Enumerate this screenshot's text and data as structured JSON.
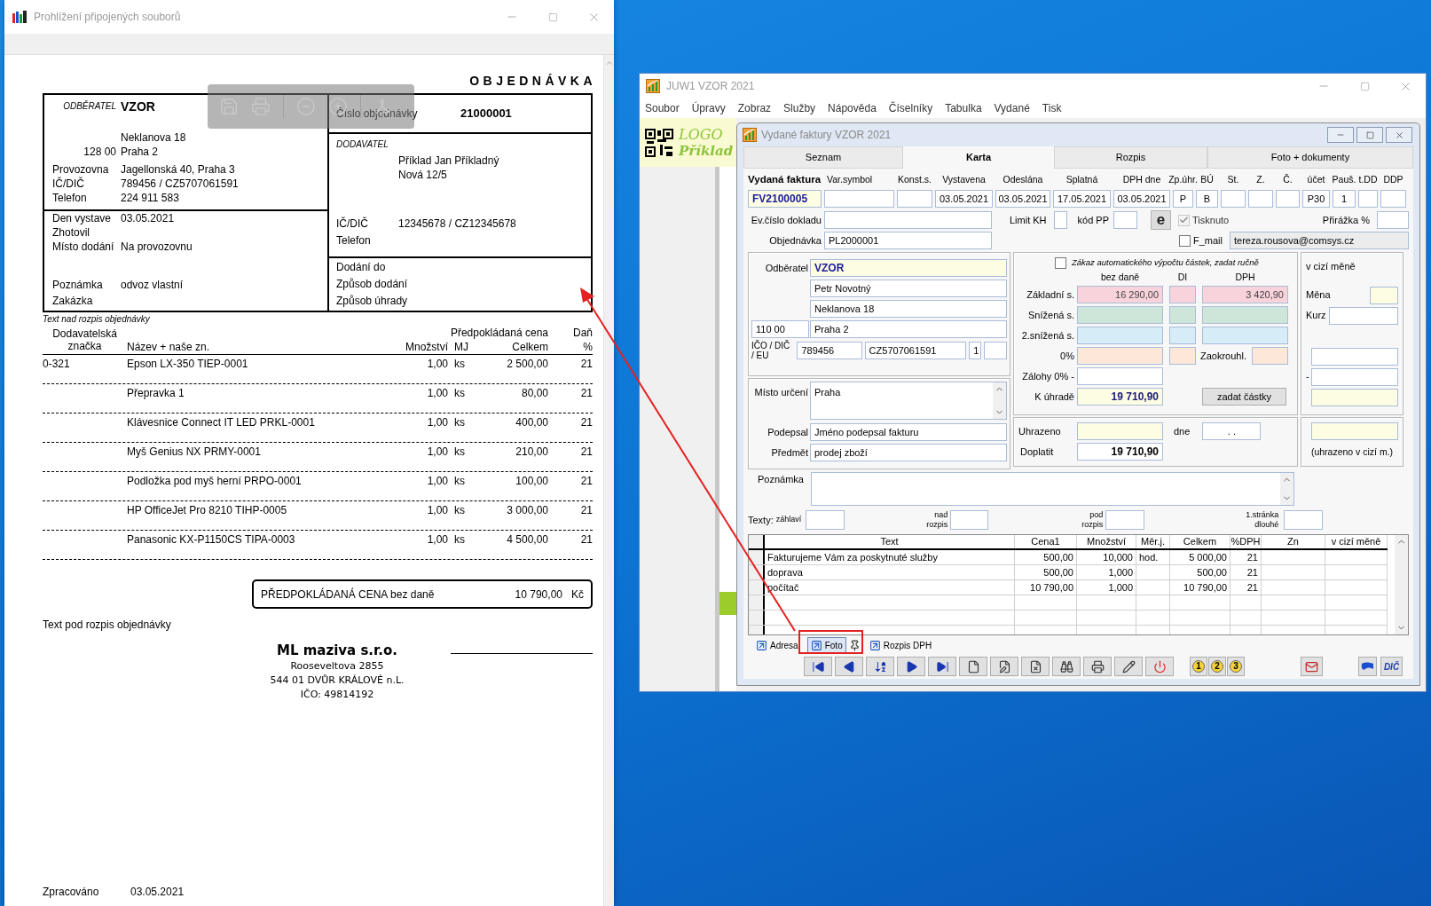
{
  "left_window": {
    "title": "Prohlížení připojených souborů",
    "document": {
      "heading": "OBJEDNÁVKA",
      "customer": {
        "label": "ODBĚRATEL",
        "name": "VZOR",
        "street": "Neklanova 18",
        "zip": "128 00",
        "city": "Praha 2",
        "details": [
          {
            "label": "Provozovna",
            "value": "Jagellonská 40, Praha 3"
          },
          {
            "label": "IČ/DIČ",
            "value": "789456 / CZ5707061591"
          },
          {
            "label": "Telefon",
            "value": "224 911 583"
          }
        ]
      },
      "order_info": [
        {
          "label": "Den vystave",
          "value": "03.05.2021"
        },
        {
          "label": "Zhotovil"
        },
        {
          "label": "Místo dodání",
          "value": "Na provozovnu"
        }
      ],
      "notes": [
        {
          "label": "Poznámka",
          "value": "odvoz vlastní"
        },
        {
          "label": "Zakázka"
        }
      ],
      "order_number": {
        "label": "Číslo objednávky",
        "value": "21000001"
      },
      "supplier": {
        "label": "DODAVATEL",
        "name": "Příklad Jan Příkladný",
        "street": "Nová 12/5",
        "details": [
          {
            "label": "IČ/DIČ",
            "value": "12345678 / CZ12345678"
          },
          {
            "label": "Telefon"
          }
        ]
      },
      "delivery": [
        "Dodání do",
        "Způsob dodání",
        "Způsob úhrady"
      ],
      "text_above": "Text nad rozpis objednávky",
      "columns": {
        "code": "Dodavatelská značka",
        "name": "Název + naše zn.",
        "qty": "Množství",
        "unit": "MJ",
        "price": "Předpokládaná cena",
        "total": "Celkem",
        "tax": "Daň",
        "tax_unit": "%"
      },
      "rows": [
        {
          "code": "0-321",
          "name": "Epson LX-350 TIEP-0001",
          "qty": "1,00",
          "unit": "ks",
          "total": "2 500,00",
          "tax": "21"
        },
        {
          "name": "Přepravka 1",
          "qty": "1,00",
          "unit": "ks",
          "total": "80,00",
          "tax": "21"
        },
        {
          "name": "Klávesnice Connect IT LED PRKL-0001",
          "qty": "1,00",
          "unit": "ks",
          "total": "400,00",
          "tax": "21"
        },
        {
          "name": "Myš Genius NX PRMY-0001",
          "qty": "1,00",
          "unit": "ks",
          "total": "210,00",
          "tax": "21"
        },
        {
          "name": "Podložka pod myš herní PRPO-0001",
          "qty": "1,00",
          "unit": "ks",
          "total": "100,00",
          "tax": "21"
        },
        {
          "name": "HP OfficeJet Pro 8210 TIHP-0005",
          "qty": "1,00",
          "unit": "ks",
          "total": "3 000,00",
          "tax": "21"
        },
        {
          "name": "Panasonic KX-P1150CS TIPA-0003",
          "qty": "1,00",
          "unit": "ks",
          "total": "4 500,00",
          "tax": "21"
        }
      ],
      "total": {
        "label": "PŘEDPOKLÁDANÁ CENA bez daně",
        "value": "10 790,00",
        "currency": "Kč"
      },
      "text_below": "Text pod rozpis objednávky",
      "stamp": {
        "company": "ML maziva s.r.o.",
        "lines": [
          "Rooseveltova 2855",
          "544 01 DVŮR KRÁLOVÉ n.L.",
          "IČO: 49814192"
        ]
      },
      "processed": {
        "label": "Zpracováno",
        "value": "03.05.2021"
      }
    }
  },
  "app_window": {
    "title": "JUW1 VZOR 2021",
    "menu": [
      "Soubor",
      "Úpravy",
      "Zobraz",
      "Služby",
      "Nápověda",
      "Číselníky",
      "Tabulka",
      "Vydané",
      "Tisk"
    ],
    "logo": {
      "line1": "LOGO",
      "line2": "Příklad"
    },
    "child_window": {
      "title": "Vydané faktury VZOR 2021",
      "tabs": [
        {
          "label": "Seznam",
          "selected": false
        },
        {
          "label": "Karta",
          "selected": true
        },
        {
          "label": "Rozpis",
          "selected": false
        },
        {
          "label": "Foto + dokumenty",
          "selected": false
        }
      ],
      "header_fields": [
        {
          "label": "Vydaná faktura",
          "value": "FV2100005"
        },
        {
          "label": "Var.symbol"
        },
        {
          "label": "Konst.s."
        },
        {
          "label": "Vystavena",
          "value": "03.05.2021"
        },
        {
          "label": "Odeslána",
          "value": "03.05.2021"
        },
        {
          "label": "Splatná",
          "value": "17.05.2021"
        },
        {
          "label": "DPH dne",
          "value": "03.05.2021"
        },
        {
          "label": "Zp.úhr.",
          "value": "P"
        },
        {
          "label": "BÚ",
          "value": "B"
        },
        {
          "label": "St."
        },
        {
          "label": "Z."
        },
        {
          "label": "Č."
        },
        {
          "label": "účet",
          "value": "P30"
        },
        {
          "label": "Pauš.",
          "value": "1"
        },
        {
          "label": "t.DD"
        },
        {
          "label": "DDP"
        }
      ],
      "ev_number": {
        "label": "Ev.číslo dokladu"
      },
      "limit_kh": {
        "label": "Limit KH"
      },
      "pp_code": {
        "label": "kód PP"
      },
      "web_button": "e",
      "printed": {
        "label": "Tisknuto",
        "checked": true,
        "disabled": true
      },
      "markup": {
        "label": "Přirážka %"
      },
      "order": {
        "label": "Objednávka",
        "value": "PL2000001"
      },
      "email_flag": {
        "label": "F_mail",
        "checked": false,
        "disabled": false
      },
      "email": "tereza.rousova@comsys.cz",
      "customer": {
        "label": "Odběratel",
        "name": "VZOR",
        "contact": "Petr Novotný",
        "street": "Neklanova 18",
        "zip": "110 00",
        "city": "Praha 2",
        "id_label": "IČO / DIČ / EU",
        "ico": "789456",
        "dic": "CZ5707061591",
        "eu": "1"
      },
      "destination": {
        "label": "Místo určení",
        "value": "Praha"
      },
      "signed": {
        "label": "Podepsal",
        "value": "Jméno podepsal fakturu"
      },
      "subject": {
        "label": "Předmět",
        "value": "prodej zboží"
      },
      "amounts": {
        "manual": {
          "label": "Zákaz automatického výpočtu částek, zadat ručně",
          "checked": false
        },
        "headers": [
          "bez daně",
          "DI",
          "DPH"
        ],
        "rows": [
          {
            "label": "Základní s.",
            "base": "16 290,00",
            "vat": "3 420,90",
            "color": "#f9d3dc"
          },
          {
            "label": "Snížená s.",
            "color": "#cde6d9"
          },
          {
            "label": "2.snížená s.",
            "color": "#d6ecf7"
          },
          {
            "label": "0%",
            "rounding_label": "Zaokrouhl.",
            "color": "#fde7d9"
          }
        ],
        "advances": {
          "label": "Zálohy 0% -"
        },
        "to_pay": {
          "label": "K úhradě",
          "value": "19 710,90"
        },
        "button": "zadat částky"
      },
      "foreign": {
        "title": "v cizí měně",
        "currency_label": "Měna",
        "rate_label": "Kurz",
        "minus": "-",
        "paid_note": "(uhrazeno v cizí m.)"
      },
      "payment": {
        "paid_label": "Uhrazeno",
        "date_label": "dne",
        "date_value": ". .",
        "remaining_label": "Doplatit",
        "remaining": "19 710,90"
      },
      "note": {
        "label": "Poznámka"
      },
      "texts": {
        "label": "Texty:",
        "fields": [
          "záhlaví",
          "nad rozpis",
          "pod rozpis",
          "1.stránka dlouhé"
        ]
      },
      "items_table": {
        "columns": [
          "Text",
          "Cena1",
          "Množství",
          "Měr.j.",
          "Celkem",
          "%DPH",
          "Zn",
          "v cizí měně"
        ],
        "rows": [
          {
            "text": "Fakturujeme Vám za poskytnuté služby",
            "price": "500,00",
            "qty": "10,000",
            "unit": "hod.",
            "total": "5 000,00",
            "vat": "21"
          },
          {
            "text": "doprava",
            "price": "500,00",
            "qty": "1,000",
            "total": "500,00",
            "vat": "21"
          },
          {
            "text": "počítač",
            "price": "10 790,00",
            "qty": "1,000",
            "total": "10 790,00",
            "vat": "21"
          }
        ]
      },
      "bottom_tabs": [
        {
          "label": "Adresa",
          "selected": false
        },
        {
          "label": "Foto",
          "selected": true
        },
        {
          "label": "Rozpis DPH",
          "selected": false
        }
      ],
      "toolbar_digits": [
        "1",
        "2",
        "3"
      ],
      "dic_button": "DIČ"
    }
  }
}
